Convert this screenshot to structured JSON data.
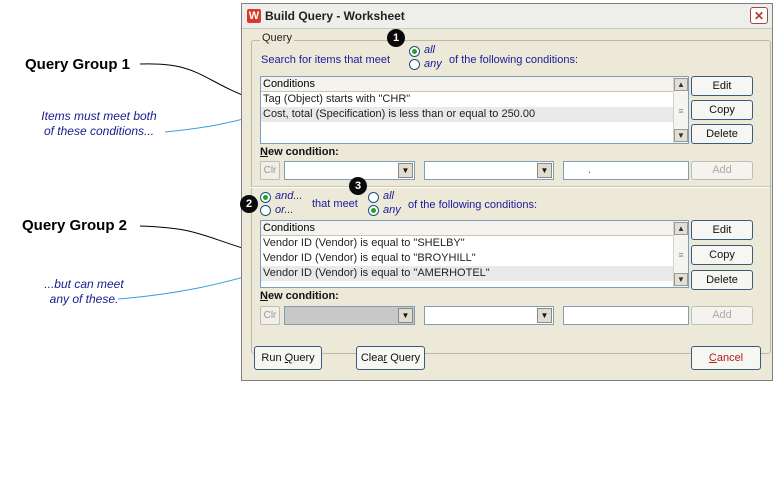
{
  "callouts": {
    "group1_title": "Query Group 1",
    "group1_note_line1": "Items must meet both",
    "group1_note_line2": "of these conditions...",
    "group2_title": "Query Group 2",
    "group2_note_line1": "...but can meet",
    "group2_note_line2": "any of these."
  },
  "window": {
    "title": "Build Query - Worksheet",
    "close_glyph": "✕"
  },
  "badges": [
    "1",
    "2",
    "3"
  ],
  "query": {
    "legend": "Query",
    "search_prefix": "Search for items that meet",
    "opt_all": "all",
    "opt_any": "any",
    "search_suffix": "of the following conditions:",
    "selected": "all",
    "list_header": "Conditions",
    "conditions": [
      "Tag (Object) starts with \"CHR\"",
      "Cost, total (Specification) is less than or equal to 250.00"
    ]
  },
  "group2": {
    "opt_and": "and...",
    "opt_or": "or...",
    "joiner_selected": "and",
    "that_meet": "that meet",
    "opt_all": "all",
    "opt_any": "any",
    "selected": "any",
    "suffix": "of the following conditions:",
    "list_header": "Conditions",
    "conditions": [
      "Vendor ID (Vendor) is equal to \"SHELBY\"",
      "Vendor ID (Vendor) is equal to \"BROYHILL\"",
      "Vendor ID (Vendor) is equal to \"AMERHOTEL\""
    ]
  },
  "buttons": {
    "edit": "Edit",
    "copy": "Copy",
    "delete": "Delete",
    "add": "Add",
    "clr": "Clr"
  },
  "new_condition": {
    "label_first": "N",
    "label_rest": "ew condition:",
    "value_placeholder": "."
  },
  "footer": {
    "run_prefix": "Run ",
    "run_hot": "Q",
    "run_rest": "uery",
    "clear_prefix": "Clea",
    "clear_hot": "r",
    "clear_rest": " Query",
    "cancel_hot": "C",
    "cancel_rest": "ancel"
  },
  "icons": {
    "scroll_up": "▲",
    "scroll_down": "▼",
    "grip": "≡",
    "dropdown": "▼",
    "app": "W"
  }
}
